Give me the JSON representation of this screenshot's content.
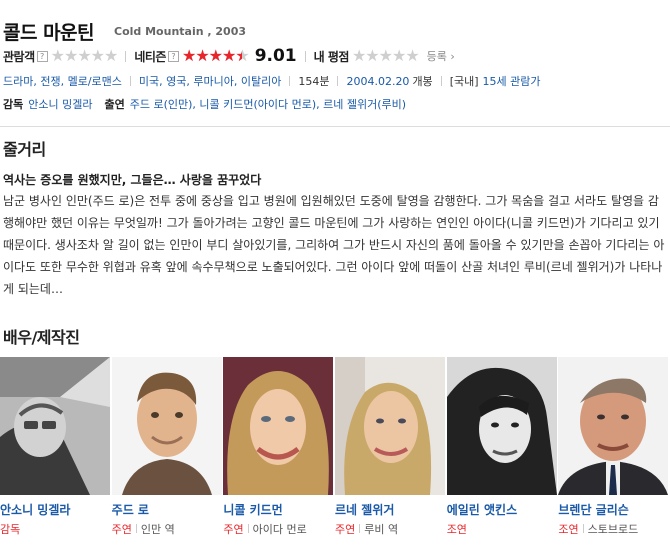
{
  "movie": {
    "title_ko": "콜드 마운틴",
    "title_en": "Cold Mountain , 2003"
  },
  "ratings": {
    "audience_label": "관람객",
    "audience_stars": 0,
    "netizen_label": "네티즌",
    "netizen_stars": 0.9,
    "netizen_score": "9.01",
    "my_label": "내 평점",
    "my_stars": 0,
    "register_label": "등록 ›",
    "accent_color": "#e8252a"
  },
  "meta": {
    "genres": "드라마, 전쟁, 멜로/로맨스",
    "countries": "미국, 영국, 루마니아, 이탈리아",
    "runtime": "154분",
    "release_date": "2004.02.20",
    "release_suffix": "개봉",
    "rating_prefix": "[국내]",
    "rating": "15세 관람가",
    "director_label": "감독",
    "director": "안소니 밍겔라",
    "cast_label": "출연",
    "cast": "주드 로(인만), 니콜 키드먼(아이다 먼로), 르네 젤위거(루비)"
  },
  "synopsis": {
    "heading": "줄거리",
    "tagline": "역사는 증오를 원했지만, 그들은… 사랑을 꿈꾸었다",
    "body": "남군 병사인 인만(주드 로)은 전투 중에 중상을 입고 병원에 입원해있던 도중에 탈영을 감행한다. 그가 목숨을 걸고 서라도 탈영을 감행해야만 했던 이유는 무엇일까! 그가 돌아가려는 고향인 콜드 마운틴에 그가 사랑하는 연인인 아이다(니콜 키드먼)가 기다리고 있기 때문이다. 생사조차 알 길이 없는 인만이 부디 살아있기를, 그리하여 그가 반드시 자신의 품에 돌아올 수 있기만을 손꼽아 기다리는 아이다도 또한 무수한 위협과 유혹 앞에 속수무책으로 노출되어있다. 그런 아이다 앞에 떠돌이 산골 처녀인 루비(르네 젤위거)가 나타나게 되는데…"
  },
  "crew": {
    "heading": "배우/제작진",
    "people": [
      {
        "name": "안소니 밍겔라",
        "role": "감독",
        "character": ""
      },
      {
        "name": "주드 로",
        "role": "주연",
        "character": "인만 역"
      },
      {
        "name": "니콜 키드먼",
        "role": "주연",
        "character": "아이다 먼로"
      },
      {
        "name": "르네 젤위거",
        "role": "주연",
        "character": "루비 역"
      },
      {
        "name": "에일린 앳킨스",
        "role": "조연",
        "character": ""
      },
      {
        "name": "브렌단 글리슨",
        "role": "조연",
        "character": "스토브로드"
      }
    ]
  }
}
